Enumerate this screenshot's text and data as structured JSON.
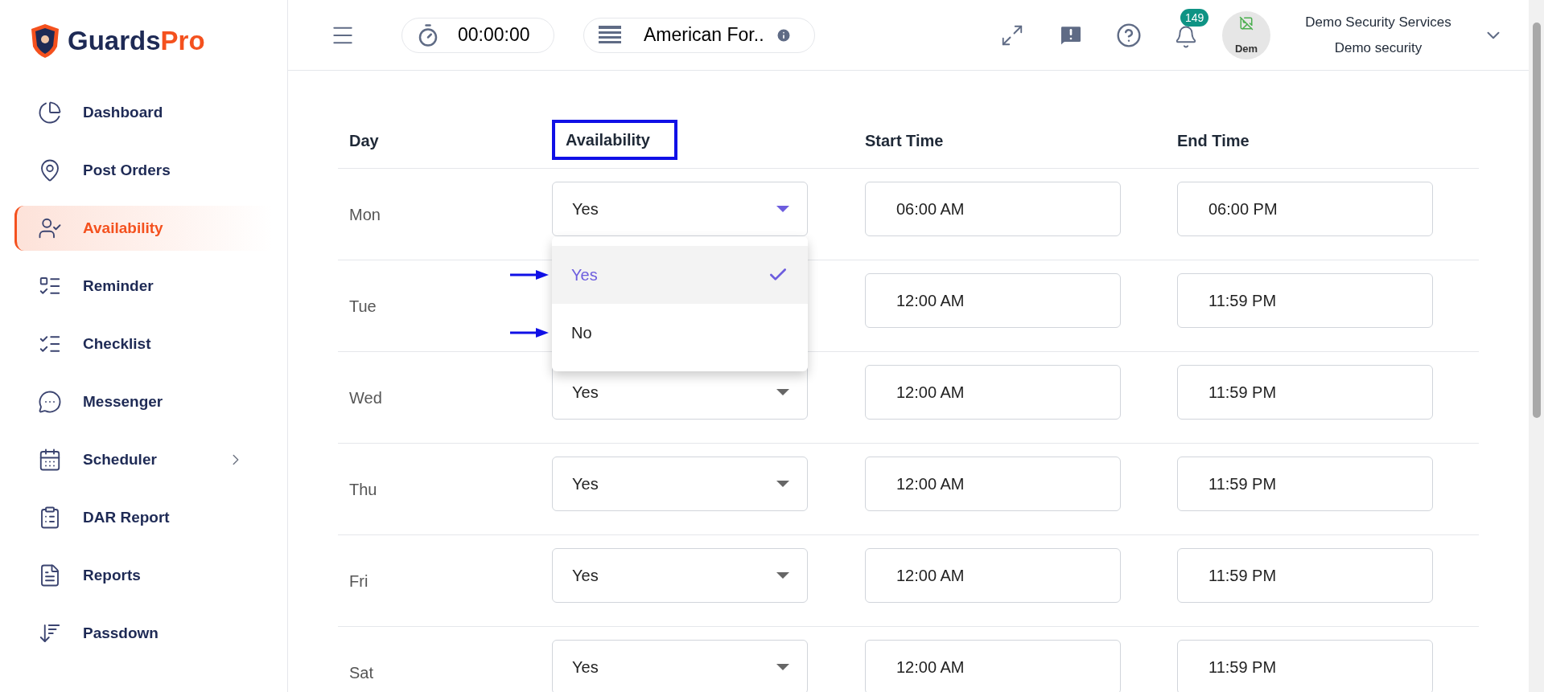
{
  "logo": {
    "text": "Guards",
    "accent": "Pro"
  },
  "sidebar": {
    "items": [
      {
        "label": "Dashboard",
        "selected": false
      },
      {
        "label": "Post Orders",
        "selected": false
      },
      {
        "label": "Availability",
        "selected": true
      },
      {
        "label": "Reminder",
        "selected": false
      },
      {
        "label": "Checklist",
        "selected": false
      },
      {
        "label": "Messenger",
        "selected": false
      },
      {
        "label": "Scheduler",
        "selected": false,
        "expandable": true
      },
      {
        "label": "DAR Report",
        "selected": false
      },
      {
        "label": "Reports",
        "selected": false
      },
      {
        "label": "Passdown",
        "selected": false
      }
    ]
  },
  "header": {
    "timer": "00:00:00",
    "site": "American For..",
    "notifications": "149",
    "avatar_alt": "Dem",
    "user_name": "Demo Security Services",
    "user_role": "Demo security"
  },
  "table": {
    "columns": [
      {
        "label": "Day",
        "highlighted": false
      },
      {
        "label": "Availability",
        "highlighted": true
      },
      {
        "label": "Start Time",
        "highlighted": false
      },
      {
        "label": "End Time",
        "highlighted": false
      }
    ],
    "rows": [
      {
        "day": "Mon",
        "availability": "Yes",
        "open": true,
        "start": "06:00 AM",
        "end": "06:00 PM"
      },
      {
        "day": "Tue",
        "start": "12:00 AM",
        "end": "11:59 PM"
      },
      {
        "day": "Wed",
        "availability": "Yes",
        "open": false,
        "start": "12:00 AM",
        "end": "11:59 PM"
      },
      {
        "day": "Thu",
        "availability": "Yes",
        "open": false,
        "start": "12:00 AM",
        "end": "11:59 PM"
      },
      {
        "day": "Fri",
        "availability": "Yes",
        "open": false,
        "start": "12:00 AM",
        "end": "11:59 PM"
      },
      {
        "day": "Sat",
        "availability": "Yes",
        "open": false,
        "start": "12:00 AM",
        "end": "11:59 PM"
      }
    ]
  },
  "dropdown": {
    "options": [
      {
        "label": "Yes",
        "selected": true,
        "pointed": true
      },
      {
        "label": "No",
        "selected": false,
        "pointed": true
      }
    ]
  }
}
